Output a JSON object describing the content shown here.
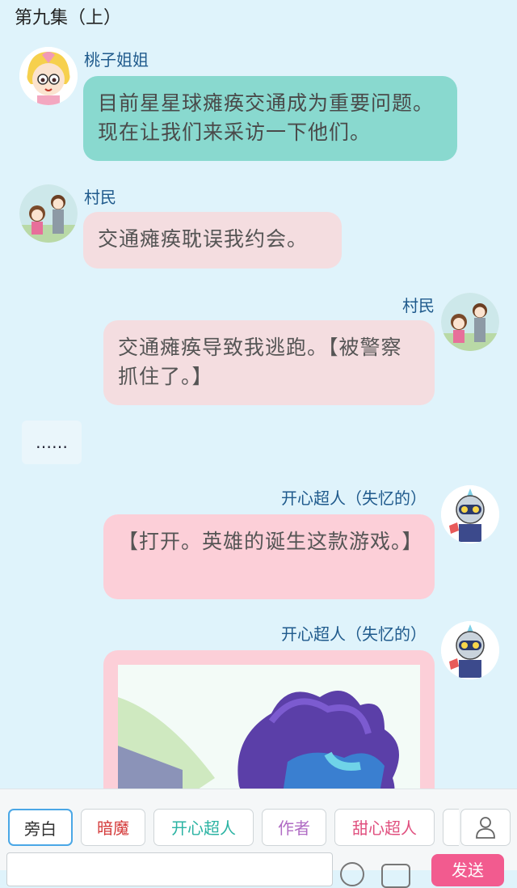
{
  "chapter_title": "第九集（上）",
  "messages": [
    {
      "name": "桃子姐姐",
      "text": "目前星星球瘫痪交通成为重要问题。现在让我们来采访一下他们。",
      "avatar": "peach-girl-icon"
    },
    {
      "name": "村民",
      "text": "交通瘫痪耽误我约会。",
      "avatar": "couple-icon"
    },
    {
      "name": "村民",
      "text": "交通瘫痪导致我逃跑。【被警察抓住了。】",
      "avatar": "couple-icon"
    },
    {
      "text": "……"
    },
    {
      "name": "开心超人（失忆的）",
      "text": "【打开。英雄的诞生这款游戏。】",
      "avatar": "robot-hero-icon"
    },
    {
      "name": "开心超人（失忆的）",
      "image": "purple-monster-image"
    }
  ],
  "roles": [
    "旁白",
    "暗魔",
    "开心超人",
    "作者",
    "甜心超人"
  ],
  "role_colors": [
    "#555555",
    "#d43a3a",
    "#2bb3a3",
    "#b06cc4",
    "#e0507f"
  ],
  "send_label": "发送",
  "colors": {
    "background": "#dff3fb",
    "teal_bubble": "#89d9cf",
    "pink_bubble": "#fccfd8",
    "send": "#f25b8f"
  }
}
